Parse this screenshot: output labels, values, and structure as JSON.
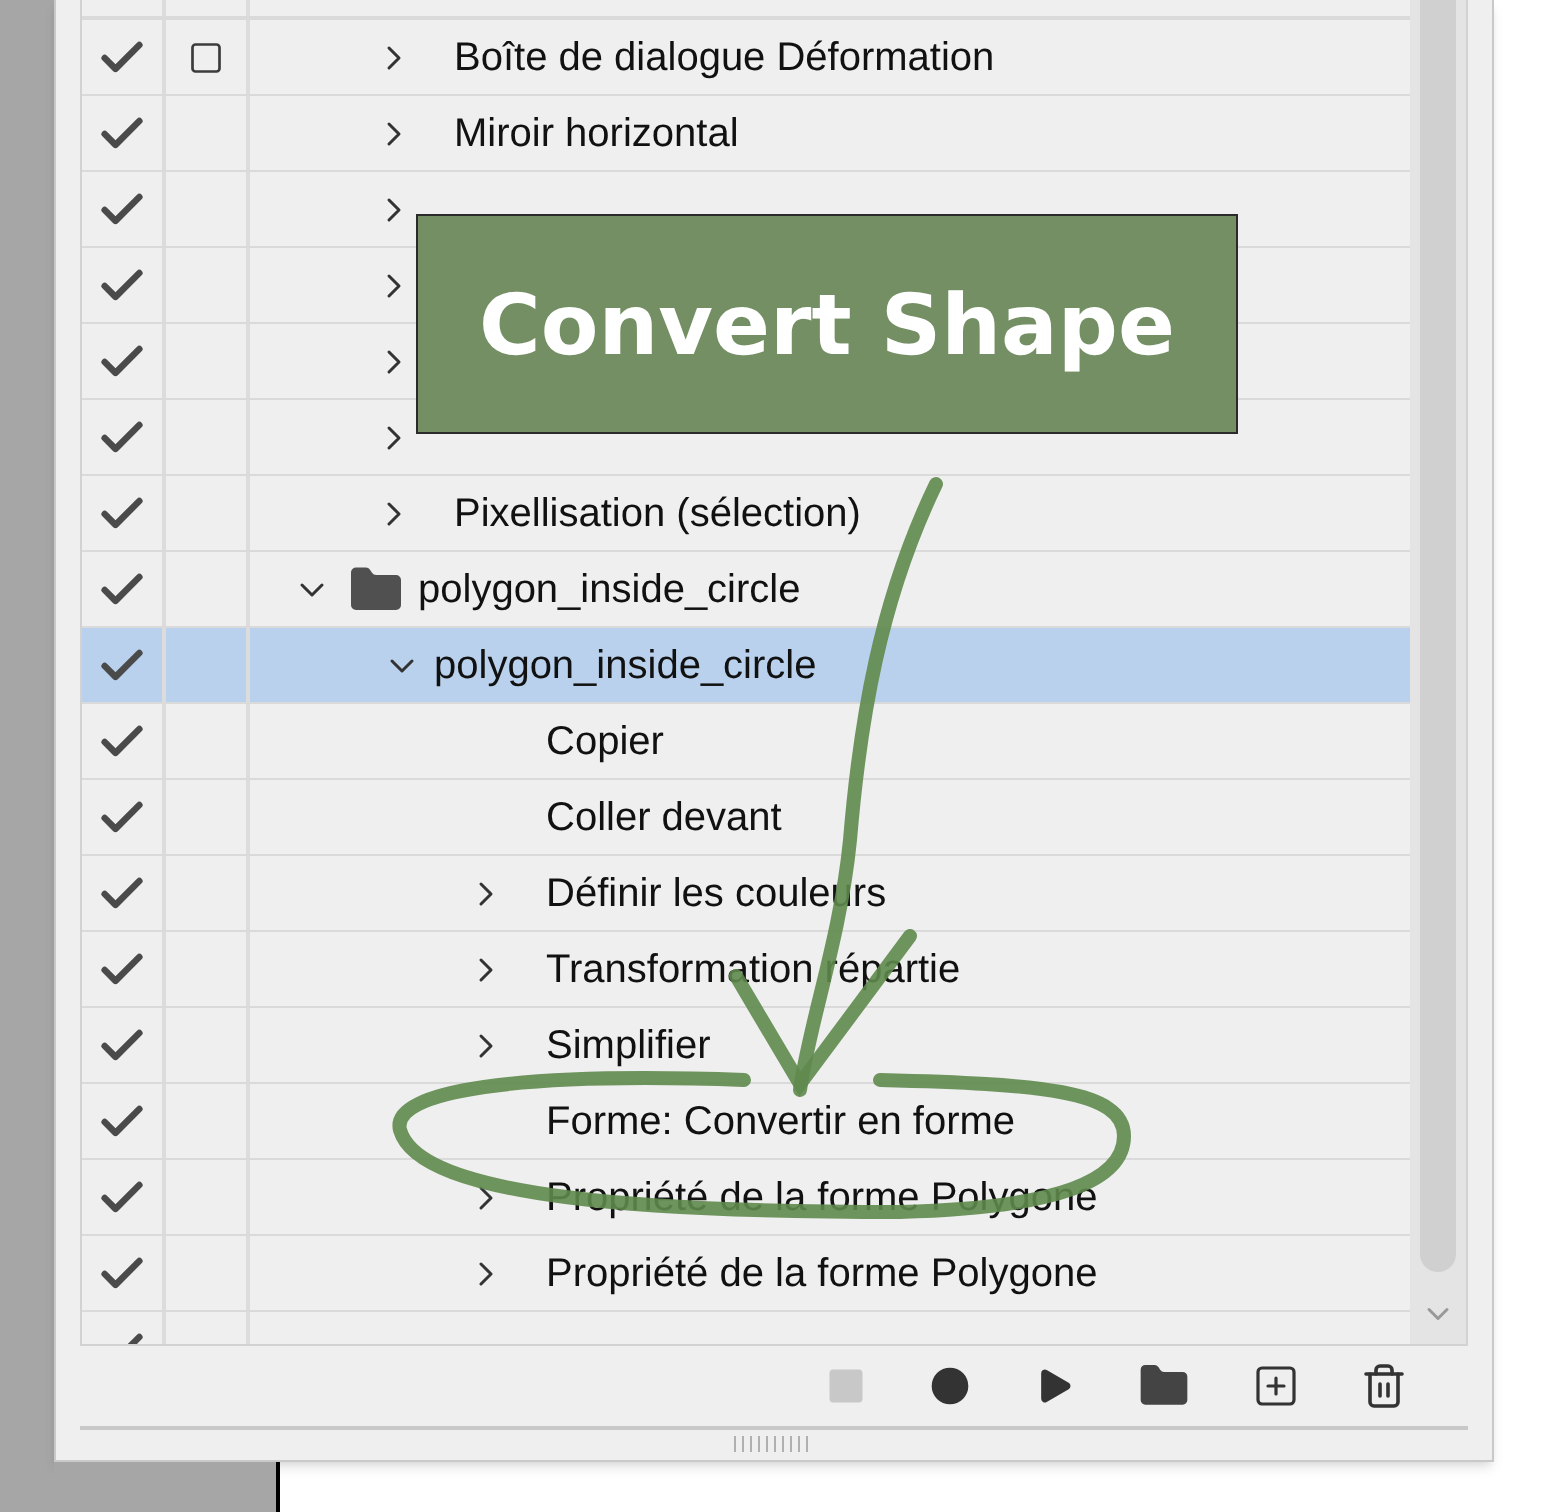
{
  "actions": [
    {
      "kind": "command",
      "label": "Boîte de dialogue Déformation",
      "enabled": true,
      "dialog": true,
      "expandable": true,
      "expanded": false,
      "selected": false
    },
    {
      "kind": "command",
      "label": "Miroir horizontal",
      "enabled": true,
      "dialog": false,
      "expandable": true,
      "expanded": false,
      "selected": false
    },
    {
      "kind": "command",
      "enabled": true,
      "dialog": false,
      "expandable": true,
      "expanded": false,
      "selected": false
    },
    {
      "kind": "command",
      "enabled": true,
      "dialog": false,
      "expandable": true,
      "expanded": false,
      "selected": false
    },
    {
      "kind": "command",
      "enabled": true,
      "dialog": false,
      "expandable": true,
      "expanded": false,
      "selected": false
    },
    {
      "kind": "command",
      "enabled": true,
      "dialog": false,
      "expandable": true,
      "expanded": false,
      "selected": false
    },
    {
      "kind": "command",
      "label": "Pixellisation (sélection)",
      "enabled": true,
      "dialog": false,
      "expandable": true,
      "expanded": false,
      "selected": false
    },
    {
      "kind": "set",
      "label": "polygon_inside_circle",
      "enabled": true,
      "dialog": false,
      "expandable": true,
      "expanded": true,
      "selected": false,
      "children": [
        {
          "kind": "action",
          "label": "polygon_inside_circle",
          "enabled": true,
          "dialog": false,
          "expandable": true,
          "expanded": true,
          "selected": true,
          "children": [
            {
              "kind": "command",
              "label": "Copier",
              "enabled": true,
              "dialog": false,
              "expandable": false,
              "selected": false
            },
            {
              "kind": "command",
              "label": "Coller devant",
              "enabled": true,
              "dialog": false,
              "expandable": false,
              "selected": false
            },
            {
              "kind": "command",
              "label": "Définir les couleurs",
              "enabled": true,
              "dialog": false,
              "expandable": true,
              "expanded": false,
              "selected": false
            },
            {
              "kind": "command",
              "label": "Transformation répartie",
              "enabled": true,
              "dialog": false,
              "expandable": true,
              "expanded": false,
              "selected": false
            },
            {
              "kind": "command",
              "label": "Simplifier",
              "enabled": true,
              "dialog": false,
              "expandable": true,
              "expanded": false,
              "selected": false
            },
            {
              "kind": "command",
              "label": "Forme: Convertir en forme",
              "enabled": true,
              "dialog": false,
              "expandable": false,
              "selected": false
            },
            {
              "kind": "command",
              "label": "Propriété de la forme Polygone",
              "enabled": true,
              "dialog": false,
              "expandable": true,
              "expanded": false,
              "selected": false
            },
            {
              "kind": "command",
              "label": "Propriété de la forme Polygone",
              "enabled": true,
              "dialog": false,
              "expandable": true,
              "expanded": false,
              "selected": false
            },
            {
              "kind": "command",
              "enabled": true,
              "dialog": false,
              "expandable": false,
              "selected": false
            }
          ]
        }
      ]
    }
  ],
  "annotation": {
    "text": "Convert Shape"
  }
}
